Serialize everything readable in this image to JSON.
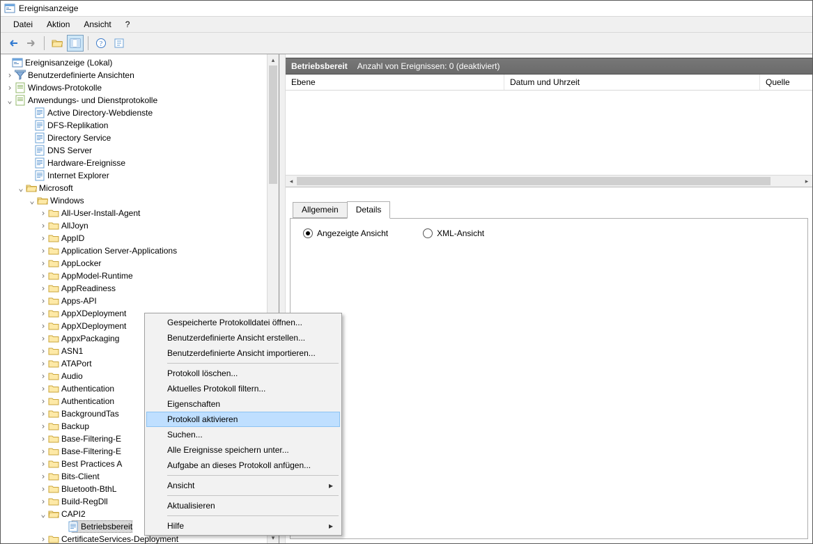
{
  "window": {
    "title": "Ereignisanzeige"
  },
  "menu": {
    "file": "Datei",
    "action": "Aktion",
    "view": "Ansicht",
    "help": "?"
  },
  "tree": {
    "root": "Ereignisanzeige (Lokal)",
    "custom_views": "Benutzerdefinierte Ansichten",
    "windows_logs": "Windows-Protokolle",
    "app_services": "Anwendungs- und Dienstprotokolle",
    "items": {
      "ad_web": "Active Directory-Webdienste",
      "dfs": "DFS-Replikation",
      "directory": "Directory Service",
      "dns": "DNS Server",
      "hardware": "Hardware-Ereignisse",
      "ie": "Internet Explorer",
      "microsoft": "Microsoft",
      "windows": "Windows"
    },
    "win_children": [
      "All-User-Install-Agent",
      "AllJoyn",
      "AppID",
      "Application Server-Applications",
      "AppLocker",
      "AppModel-Runtime",
      "AppReadiness",
      "Apps-API",
      "AppXDeployment",
      "AppXDeployment",
      "AppxPackaging",
      "ASN1",
      "ATAPort",
      "Audio",
      "Authentication",
      "Authentication",
      "BackgroundTas",
      "Backup",
      "Base-Filtering-E",
      "Base-Filtering-E",
      "Best Practices A",
      "Bits-Client",
      "Bluetooth-BthL",
      "Build-RegDll"
    ],
    "capi2": "CAPI2",
    "operational": "Betriebsbereit",
    "certsvc": "CertificateServices-Deployment"
  },
  "right": {
    "hdr_title": "Betriebsbereit",
    "hdr_sub": "Anzahl von Ereignissen: 0 (deaktiviert)",
    "col_level": "Ebene",
    "col_datetime": "Datum und Uhrzeit",
    "col_source": "Quelle",
    "tab_general": "Allgemein",
    "tab_details": "Details",
    "radio_friendly": "Angezeigte Ansicht",
    "radio_xml": "XML-Ansicht"
  },
  "ctx": {
    "open_saved": "Gespeicherte Protokolldatei öffnen...",
    "create_view": "Benutzerdefinierte Ansicht erstellen...",
    "import_view": "Benutzerdefinierte Ansicht importieren...",
    "delete_proto": "Protokoll löschen...",
    "filter_proto": "Aktuelles Protokoll filtern...",
    "properties": "Eigenschaften",
    "enable": "Protokoll aktivieren",
    "search": "Suchen...",
    "save_all": "Alle Ereignisse speichern unter...",
    "attach_task": "Aufgabe an dieses Protokoll anfügen...",
    "view": "Ansicht",
    "refresh": "Aktualisieren",
    "help": "Hilfe"
  }
}
